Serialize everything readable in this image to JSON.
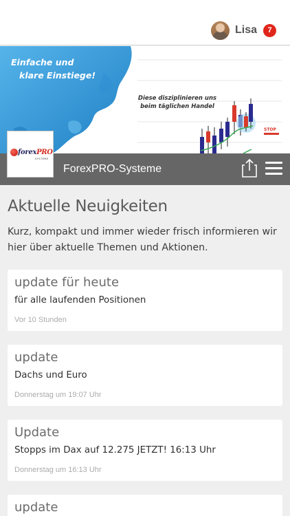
{
  "header": {
    "user_name": "Lisa",
    "notification_count": "7"
  },
  "banner": {
    "slogan_line1": "Einfache und",
    "slogan_line2": "klare Einstiege!",
    "note_line1": "Diese disziplinieren uns",
    "note_line2": "beim täglichen Handel",
    "stop_label": "STOP"
  },
  "site": {
    "logo_word": "forex",
    "logo_word_accent": "PRO",
    "logo_sub": "SYSTEME",
    "title": "ForexPRO-Systeme"
  },
  "main": {
    "heading": "Aktuelle Neuigkeiten",
    "intro": "Kurz, kompakt und immer wieder frisch informieren wir hier über aktuelle Themen und Aktionen."
  },
  "news": [
    {
      "title": "update für heute",
      "subtitle": "für alle laufenden Positionen",
      "time": "Vor 10 Stunden"
    },
    {
      "title": "update",
      "subtitle": "Dachs und Euro",
      "time": "Donnerstag um 19:07 Uhr"
    },
    {
      "title": "Update",
      "subtitle": "Stopps im Dax auf 12.275 JETZT! 16:13 Uhr",
      "time": "Donnerstag um 16:13 Uhr"
    },
    {
      "title": "update",
      "subtitle": "",
      "time": ""
    }
  ],
  "colors": {
    "accent_red": "#e0261b",
    "titlebar": "#666666",
    "banner_blue": "#3a9bdc"
  }
}
